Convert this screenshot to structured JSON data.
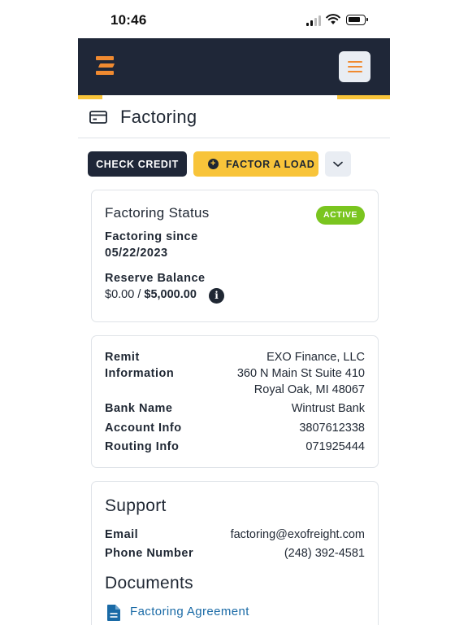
{
  "status_bar": {
    "time": "10:46"
  },
  "header": {
    "menu_label": "menu"
  },
  "page": {
    "title": "Factoring"
  },
  "actions": {
    "check_credit": "CHECK CREDIT",
    "factor_load": "FACTOR A LOAD"
  },
  "status_card": {
    "heading": "Factoring Status",
    "badge": "ACTIVE",
    "since_label": "Factoring since",
    "since_date": "05/22/2023",
    "reserve_label": "Reserve Balance",
    "reserve_current": "$0.00",
    "reserve_separator": " / ",
    "reserve_total": "$5,000.00"
  },
  "remit_card": {
    "remit_label_line1": "Remit",
    "remit_label_line2": "Information",
    "remit_name": "EXO Finance, LLC",
    "remit_street": "360 N Main St Suite 410",
    "remit_city": "Royal Oak, MI 48067",
    "bank_label": "Bank Name",
    "bank_value": "Wintrust Bank",
    "account_label": "Account Info",
    "account_value": "3807612338",
    "routing_label": "Routing Info",
    "routing_value": "071925444"
  },
  "support_card": {
    "support_heading": "Support",
    "email_label": "Email",
    "email_value": "factoring@exofreight.com",
    "phone_label": "Phone Number",
    "phone_value": "(248) 392-4581",
    "documents_heading": "Documents",
    "document_link": "Factoring Agreement"
  },
  "colors": {
    "navy": "#1f2738",
    "accent_yellow": "#f8c43a",
    "logo_orange": "#f08a30",
    "active_green": "#7ac51f",
    "link_blue": "#1a6aa6"
  },
  "icons": [
    "signal-icon",
    "wifi-icon",
    "battery-icon",
    "logo-icon",
    "hamburger-icon",
    "credit-card-icon",
    "plus-circle-icon",
    "chevron-down-icon",
    "info-icon",
    "document-icon"
  ]
}
